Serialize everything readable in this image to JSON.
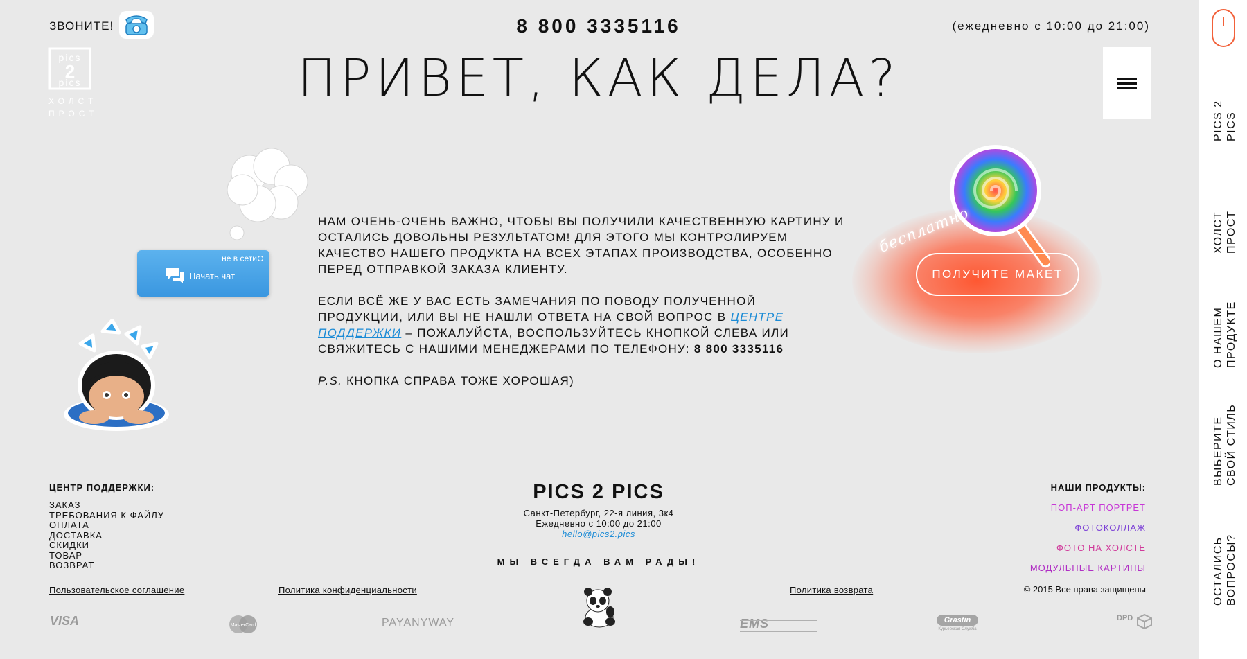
{
  "header": {
    "call_label": "ЗВОНИТЕ!",
    "phone": "8 800 3335116",
    "hours": "(ежедневно с 10:00 до 21:00)",
    "headline": "ПРИВЕТ, КАК ДЕЛА?",
    "logo": {
      "line1": "pics",
      "line2": "2",
      "line3": "pics",
      "sub1": "ХОЛСТ",
      "sub2": "ПРОСТ"
    }
  },
  "rail": {
    "items": [
      "PICS 2 PICS",
      "ХОЛСТ ПРОСТ",
      "О НАШЕМ ПРОДУКТЕ",
      "ВЫБЕРИТЕ СВОЙ СТИЛЬ",
      "ОСТАЛИСЬ ВОПРОСЫ?"
    ]
  },
  "chat": {
    "status": "не в сети",
    "label": "Начать чат"
  },
  "main": {
    "p1": "НАМ ОЧЕНЬ-ОЧЕНЬ ВАЖНО, ЧТОБЫ ВЫ ПОЛУЧИЛИ КАЧЕСТВЕННУЮ КАРТИНУ И ОСТАЛИСЬ ДОВОЛЬНЫ РЕЗУЛЬТАТОМ! ДЛЯ ЭТОГО МЫ КОНТРОЛИРУЕМ КАЧЕСТВО НАШЕГО ПРОДУКТА НА ВСЕХ ЭТАПАХ ПРОИЗВОДСТВА, ОСОБЕННО ПЕРЕД ОТПРАВКОЙ ЗАКАЗА КЛИЕНТУ.",
    "p2_before": "ЕСЛИ ВСЁ ЖЕ У ВАС ЕСТЬ ЗАМЕЧАНИЯ ПО ПОВОДУ ПОЛУЧЕННОЙ ПРОДУКЦИИ, ИЛИ ВЫ НЕ НАШЛИ ОТВЕТА НА СВОЙ ВОПРОС В ",
    "p2_link": "ЦЕНТРЕ ПОДДЕРЖКИ",
    "p2_after": " – ПОЖАЛУЙСТА, ВОСПОЛЬЗУЙТЕСЬ КНОПКОЙ СЛЕВА ИЛИ СВЯЖИТЕСЬ С НАШИМИ МЕНЕДЖЕРАМИ ПО ТЕЛЕФОНУ: ",
    "p2_phone": "8 800 3335116",
    "ps_label": "P.S.",
    "ps_text": " КНОПКА СПРАВА ТОЖЕ ХОРОШАЯ)"
  },
  "promo": {
    "free_label": "бесплатно",
    "cta": "ПОЛУЧИТЕ МАКЕТ"
  },
  "footer": {
    "support_title": "ЦЕНТР ПОДДЕРЖКИ:",
    "support_links": [
      "ЗАКАЗ",
      "ТРЕБОВАНИЯ К ФАЙЛУ",
      "ОПЛАТА",
      "ДОСТАВКА",
      "СКИДКИ",
      "ТОВАР",
      "ВОЗВРАТ"
    ],
    "brand": "PICS 2 PICS",
    "address": "Санкт-Петербург, 22-я линия, 3к4",
    "hours": "Ежедневно с 10:00 до 21:00",
    "email": "hello@pics2.pics",
    "welcome": "МЫ ВСЕГДА ВАМ РАДЫ!",
    "products_title": "НАШИ ПРОДУКТЫ:",
    "products": [
      {
        "label": "ПОП-АРТ ПОРТРЕТ",
        "color": "#c737d6"
      },
      {
        "label": "ФОТОКОЛЛАЖ",
        "color": "#7b3fd6"
      },
      {
        "label": "ФОТО НА ХОЛСТЕ",
        "color": "#d0399a"
      },
      {
        "label": "МОДУЛЬНЫЕ КАРТИНЫ",
        "color": "#b02fc4"
      }
    ],
    "legal": {
      "agreement": "Пользовательское соглашение",
      "privacy": "Политика конфиденциальности",
      "return": "Политика возврата"
    },
    "copyright": "© 2015 Все права защищены",
    "payments": {
      "visa": "VISA",
      "mastercard": "MasterCard",
      "payanyway": "PAYANYWAY",
      "ems": "EMS",
      "grastin": "Grastin",
      "grastin_sub": "Курьерская Служба",
      "dpd": "DPD"
    }
  },
  "colors": {
    "accent": "#f2613a",
    "link": "#1b8bd6",
    "chat": "#4aa5e8",
    "background": "#e9e9e9"
  }
}
